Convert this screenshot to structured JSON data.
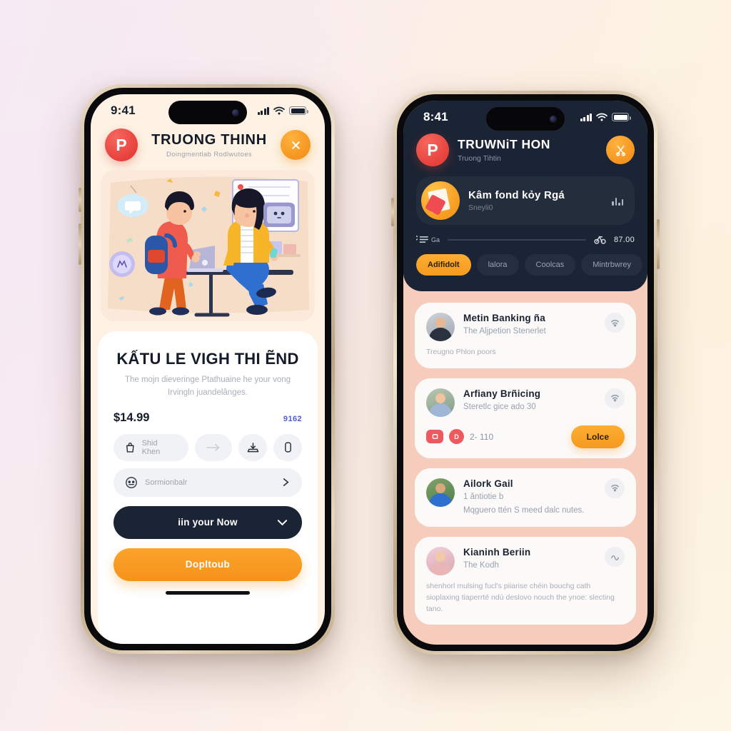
{
  "background": {
    "gradient_from": "#f6eaf4",
    "gradient_to": "#fdf6e8"
  },
  "colors": {
    "accent_orange": "#f5941e",
    "brand_red": "#e8413c",
    "dark_navy": "#1b2434",
    "peach": "#f6cdbd",
    "indigo": "#4f5bd6"
  },
  "left_phone": {
    "status_bar": {
      "time": "9:41",
      "signal_icon": "cellular-bars-icon",
      "wifi_icon": "wifi-icon",
      "battery_icon": "battery-icon"
    },
    "header": {
      "logo_glyph": "P",
      "logo_name": "brand-logo-icon",
      "title": "TRUONG THINH",
      "subtitle": "Doingmentlab Rodlwutoes",
      "close_icon": "close-icon"
    },
    "illustration": {
      "name": "students-illustration",
      "alt": "Two students with laptop and backpack"
    },
    "card": {
      "title": "KẤTU LE VIGH THI ẼND",
      "description": "The mojn dieveringe Ptathuaine he your vong Irvingln juandelânges.",
      "price": "$14.99",
      "price_note": "9162",
      "chips": [
        {
          "label": "Shid Khen",
          "icon": "shopping-bag-icon"
        },
        {
          "label": "",
          "icon": "arrow-right-icon"
        },
        {
          "label": "",
          "icon": "download-icon"
        },
        {
          "label": "",
          "icon": "battery-vertical-icon"
        }
      ],
      "select_row": {
        "label": "Sormionbalr",
        "icon": "face-icon",
        "chevron": "chevron-right-icon"
      },
      "primary_button": {
        "label": "iin your Now",
        "icon": "chevron-down-icon"
      },
      "secondary_button": {
        "label": "Dopltoub"
      }
    }
  },
  "right_phone": {
    "status_bar": {
      "time": "8:41",
      "signal_icon": "cellular-bars-icon",
      "wifi_icon": "wifi-icon",
      "battery_icon": "battery-icon"
    },
    "header": {
      "logo_glyph": "P",
      "title": "TRUWNiT HON",
      "subtitle": "Truong Tihtin",
      "action_icon": "scissors-icon"
    },
    "now_playing": {
      "title": "Kâm fond kỏy Rgá",
      "subtitle": "Sneyli0",
      "thumb_icon": "album-art-icon",
      "equalizer_icon": "equalizer-icon"
    },
    "progress": {
      "left_icon_label": "Ga",
      "left_icon": "list-icon",
      "right_icon": "bike-icon",
      "time": "87.00",
      "value_percent": 0
    },
    "tabs": [
      {
        "label": "Adifidolt",
        "active": true
      },
      {
        "label": "lalora",
        "active": false
      },
      {
        "label": "Coolcas",
        "active": false
      },
      {
        "label": "Mintrbwrey",
        "active": false
      }
    ],
    "list": [
      {
        "name": "Metin Banking ña",
        "subtitle": "The Aljpetion Stenerlet",
        "footer": "Treugno Phlon poors",
        "action_icon": "wifi-small-icon",
        "avatar": "avatar-man-dark-shirt"
      },
      {
        "name": "Arfiany Brñicing",
        "subtitle": "Steretlc gice ado 30",
        "action_icon": "wifi-small-icon",
        "avatar": "avatar-man-glasses",
        "badges": [
          {
            "icon": "camera-icon",
            "shape": "rect"
          },
          {
            "icon": "letter-d-icon",
            "shape": "round",
            "glyph": "D"
          }
        ],
        "count": "2- 110",
        "button": {
          "label": "Lolce"
        }
      },
      {
        "name": "Ailork Gail",
        "subtitle": "1 ǎntiotie b",
        "footer": "Mqguero ttén S meed dalc nutes.",
        "action_icon": "wifi-small-icon",
        "avatar": "avatar-man-blue-jersey"
      },
      {
        "name": "Kianinh Beriin",
        "subtitle": "The Kodh",
        "footer": "shenhorl mulsing fucl's piiarise chéin bouchg cath sioplaxing tiaperrté ndú deslovo nouch the ynoe: slecting tano.",
        "action_icon": "wave-icon",
        "avatar": "avatar-two-women"
      }
    ]
  }
}
